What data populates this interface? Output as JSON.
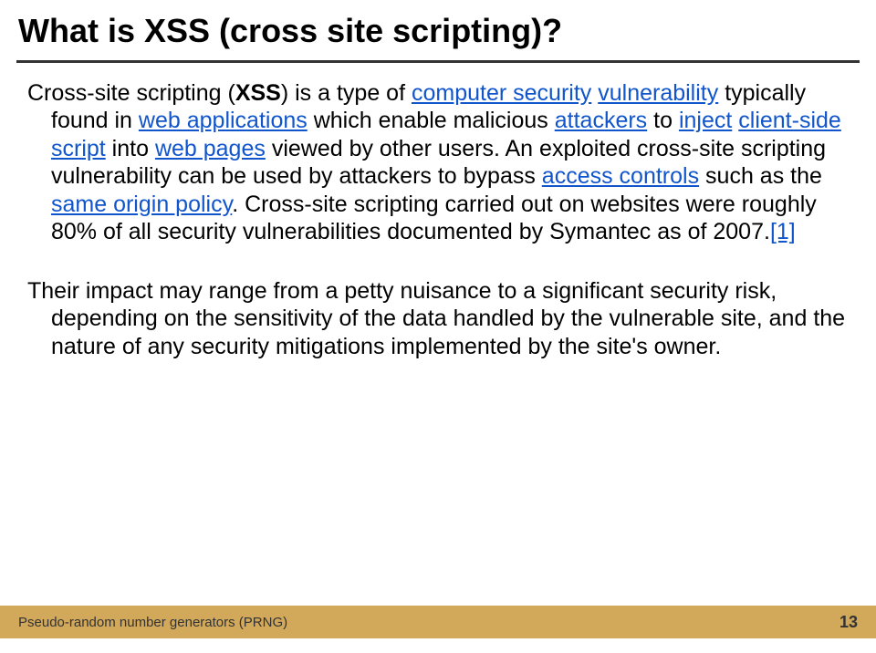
{
  "title": "What is XSS (cross site scripting)?",
  "p1": {
    "t1": "Cross-site scripting (",
    "xss": "XSS",
    "t2": ") is a type of ",
    "link1": "computer security",
    "t3": " ",
    "link2": "vulnerability",
    "t4": " typically found in ",
    "link3": "web applications",
    "t5": " which enable malicious ",
    "link4": "attackers",
    "t6": " to ",
    "link5": "inject",
    "t7": " ",
    "link6": "client-side script",
    "t8": " into ",
    "link7": "web pages",
    "t9": " viewed by other users. An exploited cross-site scripting vulnerability can be used by attackers to bypass ",
    "link8": "access controls",
    "t10": " such as the ",
    "link9": "same origin policy",
    "t11": ". Cross-site scripting carried out on websites were roughly 80% of all security vulnerabilities documented by Symantec as of 2007.",
    "link10": "[1]"
  },
  "p2": "Their impact may range from a petty nuisance to a significant security risk, depending on the sensitivity of the data handled by the vulnerable site, and the nature of any security mitigations implemented by the site's owner.",
  "footer_left": "Pseudo-random number generators (PRNG)",
  "footer_right": "13"
}
